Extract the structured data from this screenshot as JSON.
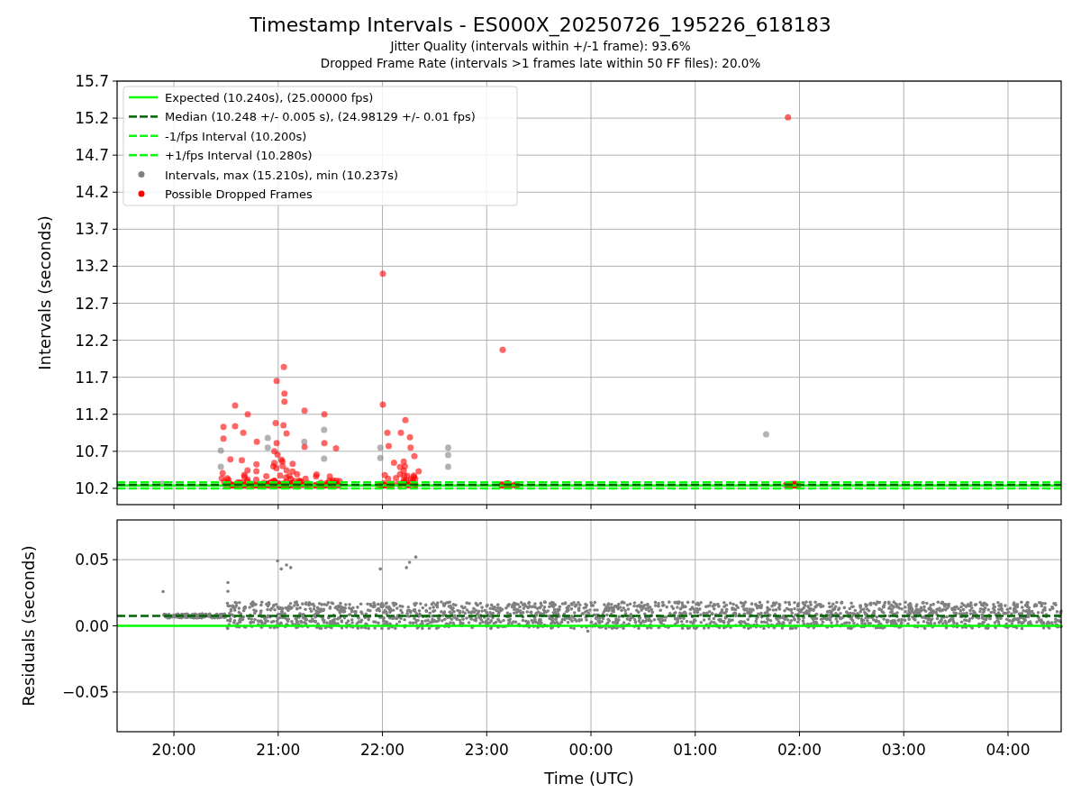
{
  "title": "Timestamp Intervals - ES000X_20250726_195226_618183",
  "subtitles": [
    "Jitter Quality (intervals within +/-1 frame): 93.6%",
    "Dropped Frame Rate (intervals >1 frames late within 50 FF files): 20.0%"
  ],
  "intervals_plot": {
    "y_axis_label": "Intervals (seconds)",
    "y_tick_labels": [
      "15.7",
      "15.2",
      "14.7",
      "14.2",
      "13.7",
      "13.2",
      "12.7",
      "12.2",
      "11.7",
      "11.2",
      "10.7",
      "10.2"
    ],
    "legend": [
      {
        "label": "Expected (10.240s), (25.00000 fps)",
        "kind": "line",
        "color": "#00ff00"
      },
      {
        "label": "Median (10.248 +/- 0.005 s), (24.98129 +/- 0.01 fps)",
        "kind": "dashed",
        "color": "#006400"
      },
      {
        "label": "-1/fps Interval (10.200s)",
        "kind": "dashed",
        "color": "#00ff00"
      },
      {
        "label": "+1/fps Interval (10.280s)",
        "kind": "dashed",
        "color": "#00ff00"
      },
      {
        "label": "Intervals, max (15.210s), min (10.237s)",
        "kind": "dot",
        "color": "#808080"
      },
      {
        "label": "Possible Dropped Frames",
        "kind": "dot",
        "color": "#ff0000"
      }
    ]
  },
  "residuals_plot": {
    "y_axis_label": "Residuals (seconds)",
    "x_axis_label": "Time (UTC)",
    "y_tick_labels": [
      "0.05",
      "0.00",
      "−0.05"
    ],
    "x_tick_labels": [
      "20:00",
      "21:00",
      "22:00",
      "23:00",
      "00:00",
      "01:00",
      "02:00",
      "03:00",
      "04:00"
    ]
  }
}
